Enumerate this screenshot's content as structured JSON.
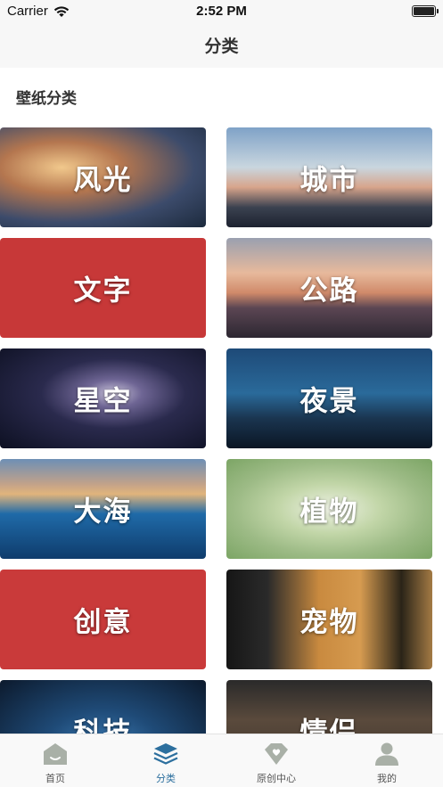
{
  "status_bar": {
    "carrier": "Carrier",
    "time": "2:52 PM"
  },
  "nav": {
    "title": "分类"
  },
  "section": {
    "title": "壁纸分类"
  },
  "categories": [
    {
      "label": "风光"
    },
    {
      "label": "城市"
    },
    {
      "label": "文字"
    },
    {
      "label": "公路"
    },
    {
      "label": "星空"
    },
    {
      "label": "夜景"
    },
    {
      "label": "大海"
    },
    {
      "label": "植物"
    },
    {
      "label": "创意"
    },
    {
      "label": "宠物"
    },
    {
      "label": "科技"
    },
    {
      "label": "情侣"
    }
  ],
  "tab_bar": {
    "items": [
      {
        "label": "首页",
        "icon": "home-icon"
      },
      {
        "label": "分类",
        "icon": "layers-icon",
        "active": true
      },
      {
        "label": "原创中心",
        "icon": "heart-badge-icon"
      },
      {
        "label": "我的",
        "icon": "profile-icon"
      }
    ]
  },
  "colors": {
    "active_tab": "#2c6f9e",
    "inactive_icon": "#a9b0a7",
    "text_card_red": "#c73838"
  }
}
